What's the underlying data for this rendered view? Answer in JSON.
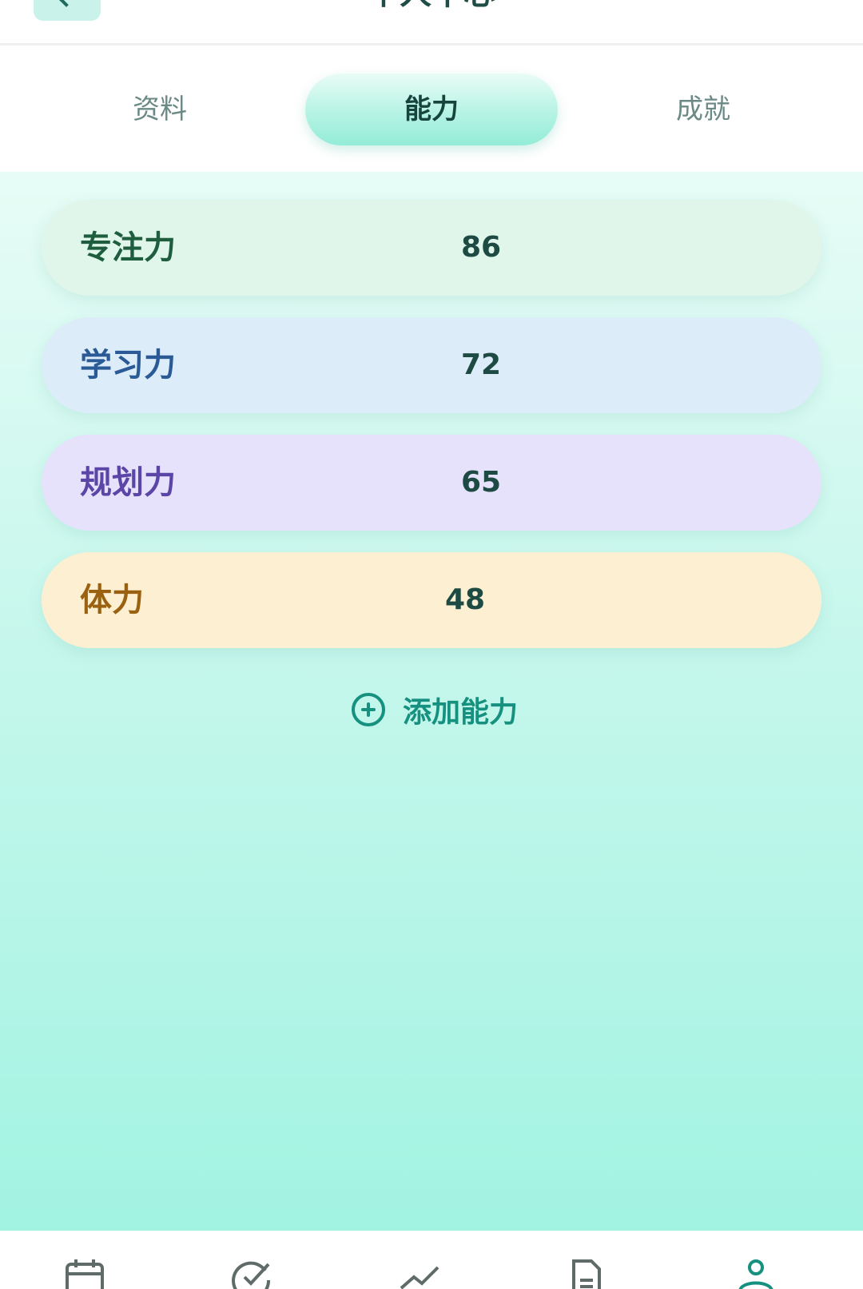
{
  "header": {
    "title": "个人中心"
  },
  "tabs": [
    {
      "label": "资料",
      "active": false
    },
    {
      "label": "能力",
      "active": true
    },
    {
      "label": "成就",
      "active": false
    }
  ],
  "abilities": [
    {
      "name": "专注力",
      "value": "86",
      "color": "#1f5d3f",
      "bg": "#e0f6ea"
    },
    {
      "name": "学习力",
      "value": "72",
      "color": "#2b5b96",
      "bg": "#dcecf8"
    },
    {
      "name": "规划力",
      "value": "65",
      "color": "#5b46a8",
      "bg": "#e6e2fb"
    },
    {
      "name": "体力",
      "value": "48",
      "color": "#9a6210",
      "bg": "#fdefd2"
    }
  ],
  "add_ability": {
    "label": "添加能力",
    "icon": "plus-circle-icon"
  },
  "bottom_nav": [
    {
      "icon": "calendar-icon"
    },
    {
      "icon": "check-circle-icon"
    },
    {
      "icon": "trend-icon"
    },
    {
      "icon": "document-icon"
    },
    {
      "icon": "user-icon",
      "active": true
    }
  ],
  "colors": {
    "accent": "#16907f",
    "tab_active_text": "#17443c",
    "tab_inactive_text": "#6b8a85"
  }
}
